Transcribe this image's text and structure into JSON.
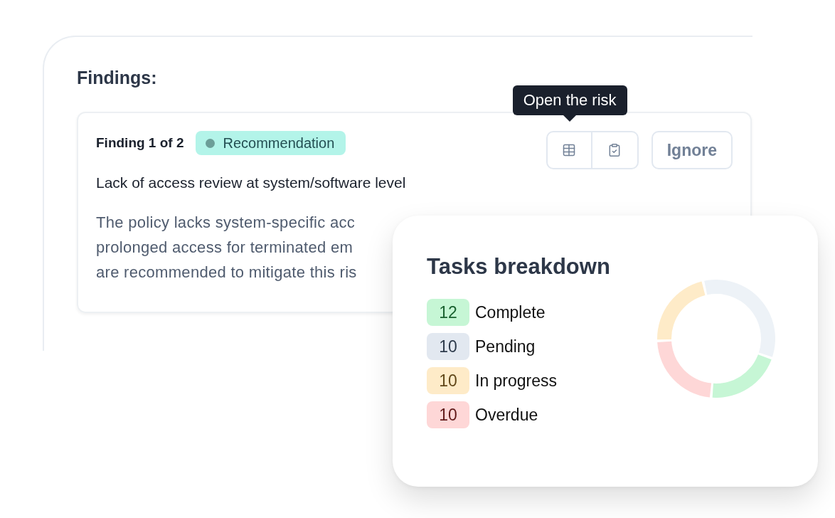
{
  "findings_panel": {
    "heading": "Findings:",
    "findings": [
      {
        "counter": "Finding 1 of 2",
        "tag": "Recommendation",
        "title": "Lack of access review at system/software level",
        "description": "The policy lacks system-specific acc\nprolonged access for terminated em\nare recommended to mitigate this ris",
        "tooltip": "Open the risk",
        "icon_buttons": [
          {
            "kind": "table"
          },
          {
            "kind": "clipboard"
          }
        ],
        "ignore_button": "Ignore"
      }
    ]
  },
  "tasks_card": {
    "title": "Tasks breakdown",
    "tasks": [
      {
        "count": "12",
        "label": "Complete",
        "color": "#c6f6d5"
      },
      {
        "count": "10",
        "label": "Pending",
        "color": "#e2e8f0"
      },
      {
        "count": "10",
        "label": "In progress",
        "color": "#feebc8"
      },
      {
        "count": "10",
        "label": "Overdue",
        "color": "#fed7d7"
      }
    ],
    "chart_data": [
      {
        "type": "donut",
        "values": [
          34,
          21,
          23,
          22
        ],
        "colors": [
          "#edf2f7",
          "#c6f6d5",
          "#fed7d7",
          "#feebc8"
        ]
      }
    ]
  }
}
